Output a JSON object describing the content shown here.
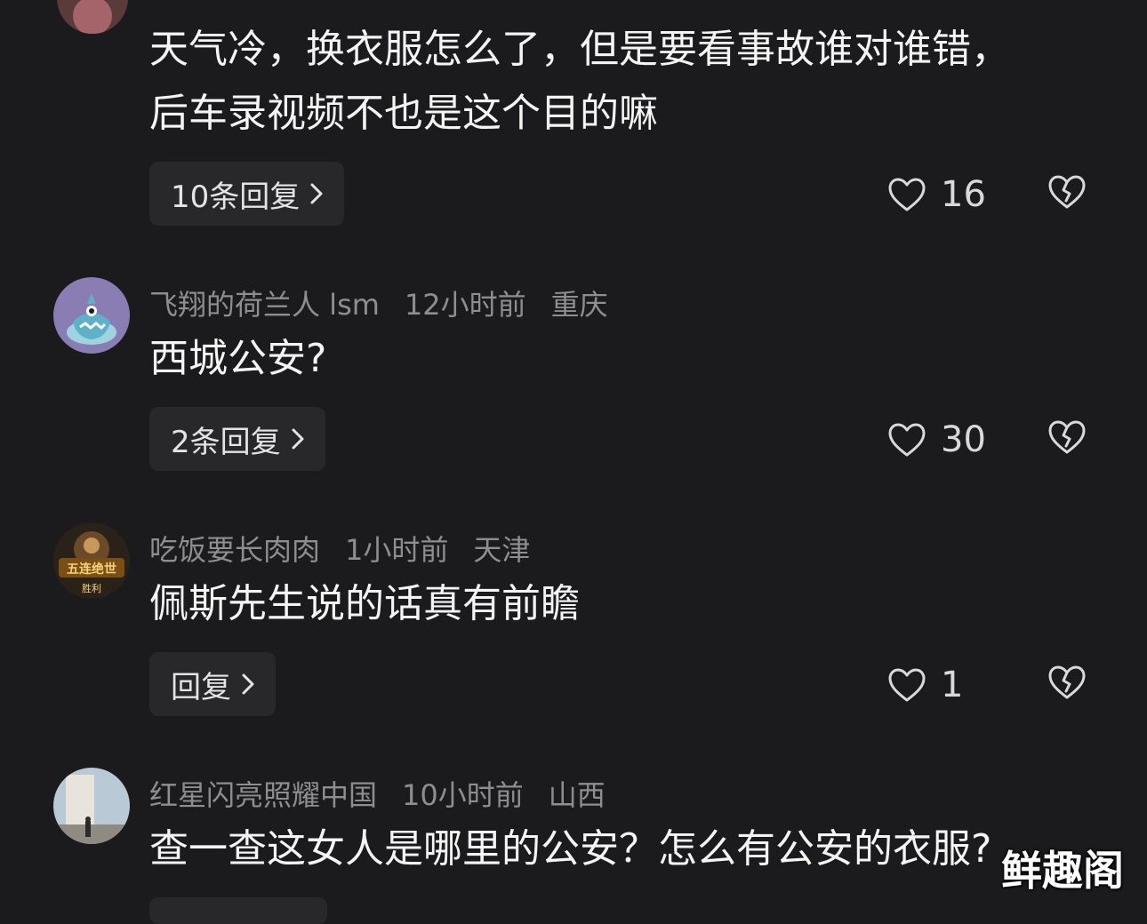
{
  "comments": [
    {
      "text_lines": [
        "天气冷，换衣服怎么了，但是要看事故谁对谁错，",
        "后车录视频不也是这个目的嘛"
      ],
      "reply_label": "10条回复",
      "likes": "16"
    },
    {
      "username": "飞翔的荷兰人 lsm",
      "time": "12小时前",
      "location": "重庆",
      "text": "西城公安?",
      "reply_label": "2条回复",
      "likes": "30"
    },
    {
      "username": "吃饭要长肉肉",
      "time": "1小时前",
      "location": "天津",
      "text": "佩斯先生说的话真有前瞻",
      "reply_label": "回复",
      "likes": "1",
      "avatar_badge_top": "五连绝世",
      "avatar_badge_bottom": "胜利"
    },
    {
      "username": "红星闪亮照耀中国",
      "time": "10小时前",
      "location": "山西",
      "text": "查一查这女人是哪里的公安？怎么有公安的衣服?"
    }
  ],
  "watermark": "鲜趣阁",
  "icons": {
    "like": "heart-outline-icon",
    "dislike": "broken-heart-icon",
    "chevron": "chevron-right-icon"
  },
  "colors": {
    "background": "#1b1b1d",
    "text": "#f4f4f4",
    "meta": "#8e8e90",
    "button_bg": "#28282a"
  }
}
